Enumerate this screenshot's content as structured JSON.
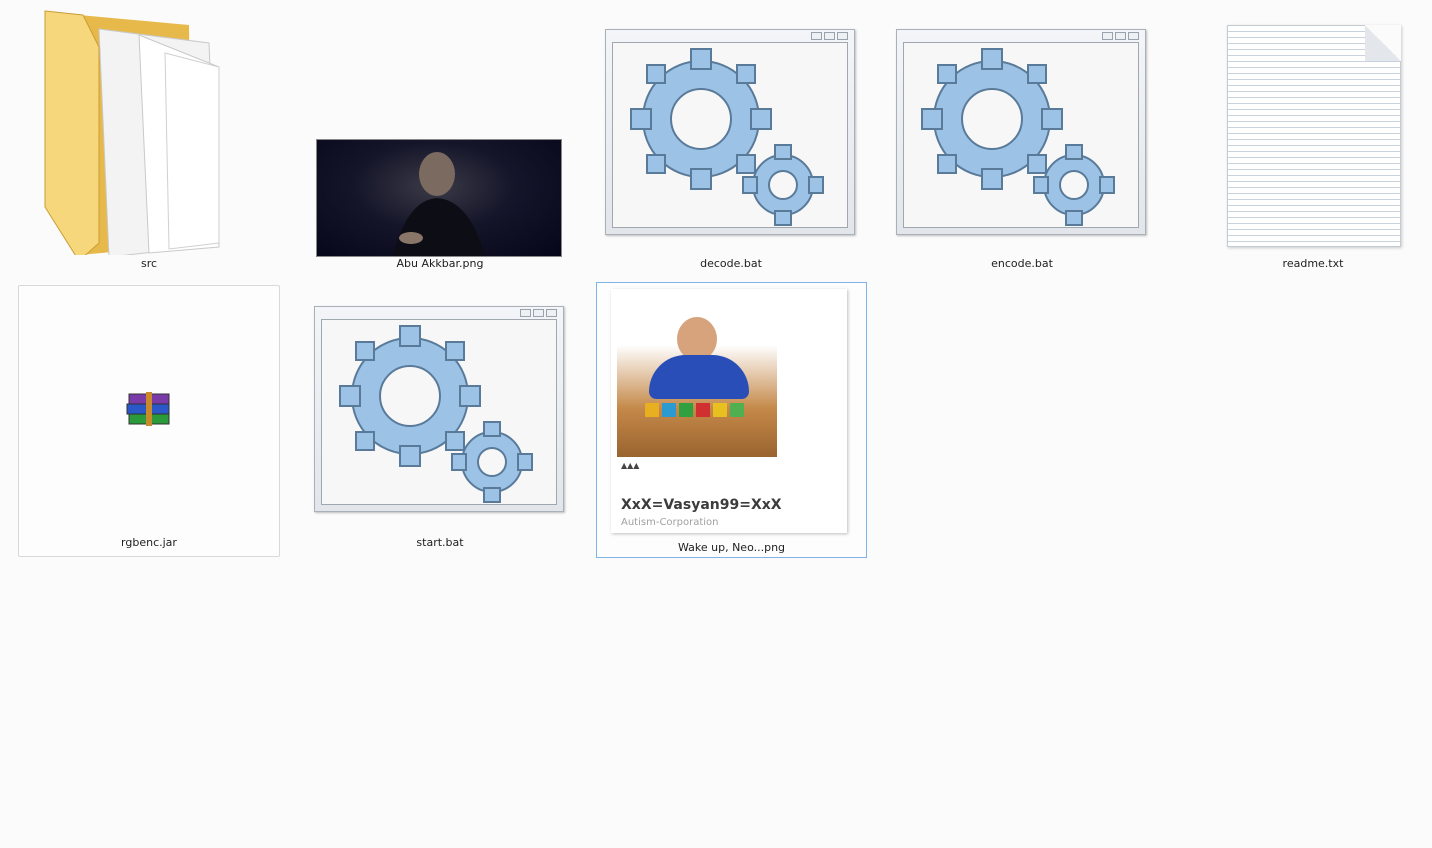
{
  "files": [
    {
      "name": "src",
      "type": "folder"
    },
    {
      "name": "Abu Akkbar.png",
      "type": "image"
    },
    {
      "name": "decode.bat",
      "type": "batch"
    },
    {
      "name": "encode.bat",
      "type": "batch"
    },
    {
      "name": "readme.txt",
      "type": "text"
    },
    {
      "name": "rgbenc.jar",
      "type": "archive"
    },
    {
      "name": "start.bat",
      "type": "batch"
    },
    {
      "name": "Wake up, Neo...png",
      "type": "image"
    }
  ],
  "preview": {
    "channel_name": "XxX=Vasyan99=XxX",
    "channel_subtitle": "Autism-Corporation",
    "meta": "▲▲▲"
  },
  "colors": {
    "selection_border": "#7eb4ea",
    "folder": "#f2cf6a",
    "gear": "#8fb8dc"
  }
}
